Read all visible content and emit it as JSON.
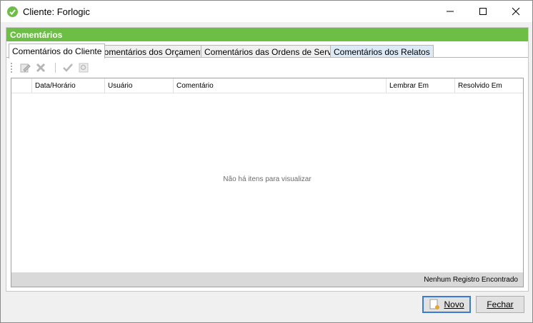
{
  "window": {
    "title": "Cliente: Forlogic",
    "app_icon": "forlogic-logo-icon"
  },
  "section": {
    "title": "Comentários"
  },
  "tabs": [
    {
      "label": "Comentários do Cliente",
      "active": true
    },
    {
      "label": "Comentários dos Orçamentos"
    },
    {
      "label": "Comentários das Ordens de Serviço"
    },
    {
      "label": "Comentários dos Relatos",
      "highlighted": true
    }
  ],
  "toolbar": {
    "icons": [
      "edit-icon",
      "delete-icon",
      "check-icon",
      "search-icon"
    ]
  },
  "grid": {
    "columns": [
      "Data/Horário",
      "Usuário",
      "Comentário",
      "Lembrar Em",
      "Resolvido Em"
    ],
    "empty_message": "Não há itens para visualizar",
    "footer_status": "Nenhum Registro Encontrado"
  },
  "buttons": {
    "novo_label": "Novo",
    "fechar_label": "Fechar"
  },
  "colors": {
    "accent": "#6cbe45",
    "primary_border": "#3a7bd5"
  }
}
